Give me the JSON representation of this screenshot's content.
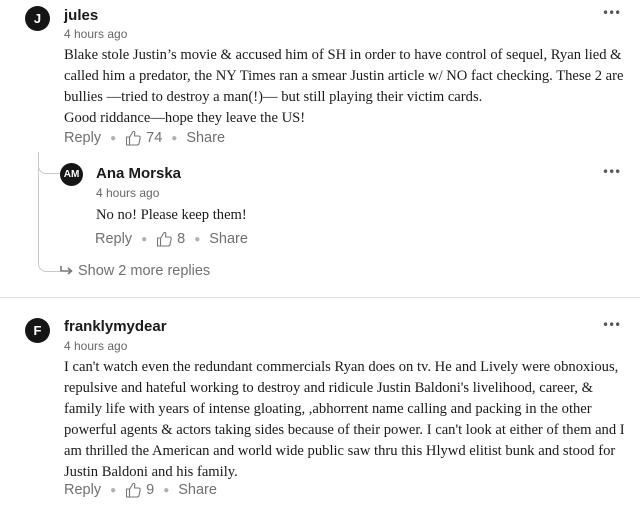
{
  "comments": [
    {
      "initials": "J",
      "author": "jules",
      "time": "4 hours ago",
      "paragraphs": [
        "Blake stole Justin’s movie & accused him of SH in order to have control of sequel, Ryan lied & called him a predator, the NY Times ran a smear Justin article w/ NO fact checking. These 2 are bullies —tried to destroy a man(!)— but still playing their victim cards.",
        "Good riddance—hope they leave the US!"
      ],
      "reply_label": "Reply",
      "likes": "74",
      "share_label": "Share",
      "replies": [
        {
          "initials": "AM",
          "author": "Ana Morska",
          "time": "4 hours ago",
          "text": "No no! Please keep them!",
          "reply_label": "Reply",
          "likes": "8",
          "share_label": "Share"
        }
      ],
      "show_more_label": "Show 2 more replies"
    },
    {
      "initials": "F",
      "author": "franklymydear",
      "time": "4 hours ago",
      "text": "I can't watch even the redundant commercials Ryan does on tv.  He and Lively were obnoxious, repulsive and hateful working to destroy and ridicule Justin Baldoni's livelihood, career, & family life with  years of intense gloating, ,abhorrent name calling and packing in the other powerful agents & actors taking sides because of their power.   I can't look at either of them and I am thrilled the American and world wide public saw thru this Hlywd elitist bunk and stood for Justin Baldoni and his family.",
      "reply_label": "Reply",
      "likes": "9",
      "share_label": "Share"
    }
  ],
  "icons": {
    "more": "more-options-icon",
    "like": "thumbs-up-icon",
    "show_more": "reply-arrow-icon"
  }
}
